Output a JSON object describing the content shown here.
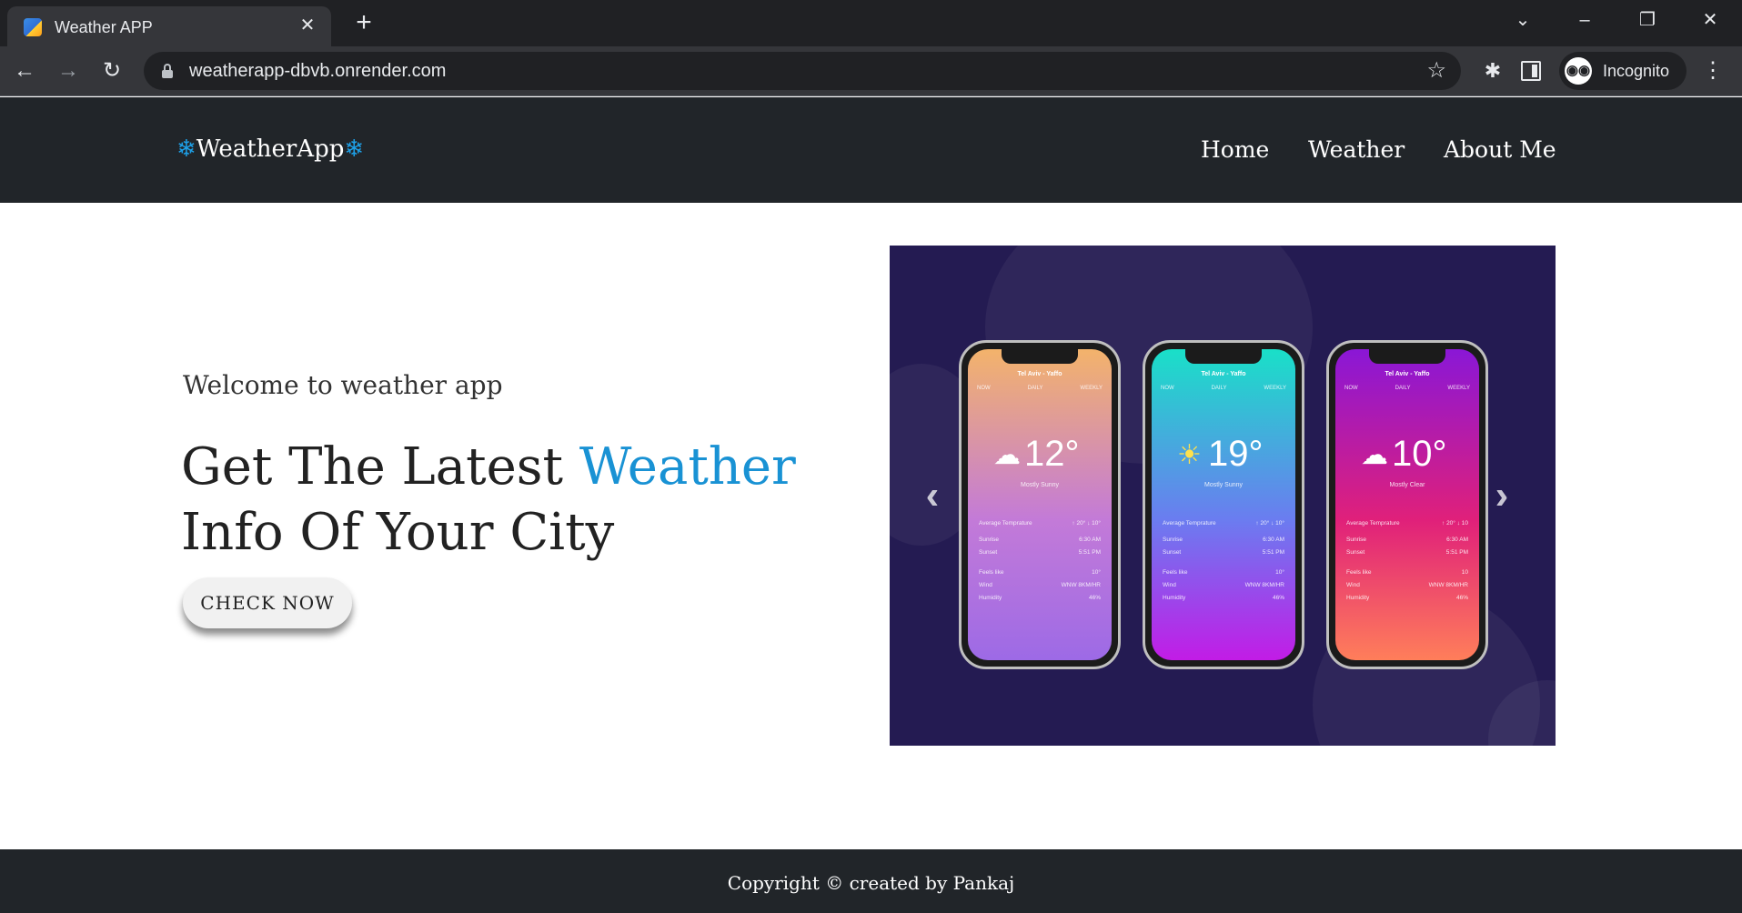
{
  "browser": {
    "tab_title": "Weather APP",
    "tab_close": "✕",
    "new_tab": "+",
    "url": "weatherapp-dbvb.onrender.com",
    "profile_label": "Incognito",
    "icons": [
      "favicon-icon",
      "close-icon",
      "plus-icon",
      "chevron-down-icon",
      "minimize-icon",
      "restore-icon",
      "close-window-icon",
      "back-icon",
      "forward-icon",
      "reload-icon",
      "lock-icon",
      "star-icon",
      "extensions-icon",
      "side-panel-icon",
      "incognito-icon",
      "menu-icon"
    ]
  },
  "site": {
    "brand": {
      "left_flake": "❄",
      "name": "WeatherApp",
      "right_flake": "❄"
    },
    "nav": [
      {
        "label": "Home"
      },
      {
        "label": "Weather"
      },
      {
        "label": "About Me"
      }
    ],
    "accent_color": "#1992d4",
    "navbar_color": "#212529"
  },
  "hero": {
    "welcome": "Welcome to weather app",
    "title_part1": "Get The Latest ",
    "title_accent": "Weather",
    "title_part2": "Info Of Your City",
    "cta_label": "CHECK NOW"
  },
  "carousel": {
    "prev_icon": "‹",
    "next_icon": "›",
    "phones": [
      {
        "city": "Tel Aviv - Yaffo",
        "tabs": [
          "NOW",
          "DAILY",
          "WEEKLY"
        ],
        "temp": "12°",
        "condition": "Mostly Sunny",
        "icon": "cloud-sun-icon",
        "gradient": [
          "#f3b36b",
          "#c37ad8",
          "#9d6ae6"
        ],
        "rows": [
          {
            "label": "Average Temprature",
            "value": "↑ 20°  ↓ 10°"
          },
          {
            "label": "Sunrise",
            "value": "6:30 AM"
          },
          {
            "label": "Sunset",
            "value": "5:51 PM"
          },
          {
            "label": "Feels like",
            "value": "10°"
          },
          {
            "label": "Wind",
            "value": "WNW 8KM/HR"
          },
          {
            "label": "Humidity",
            "value": "46%"
          }
        ]
      },
      {
        "city": "Tel Aviv - Yaffo",
        "tabs": [
          "NOW",
          "DAILY",
          "WEEKLY"
        ],
        "temp": "19°",
        "condition": "Mostly Sunny",
        "icon": "sun-icon",
        "gradient": [
          "#19e0c8",
          "#6b7cf0",
          "#c21ce6"
        ],
        "rows": [
          {
            "label": "Average Temprature",
            "value": "↑ 20°  ↓ 10°"
          },
          {
            "label": "Sunrise",
            "value": "6:30 AM"
          },
          {
            "label": "Sunset",
            "value": "5:51 PM"
          },
          {
            "label": "Feels like",
            "value": "10°"
          },
          {
            "label": "Wind",
            "value": "WNW 8KM/HR"
          },
          {
            "label": "Humidity",
            "value": "46%"
          }
        ]
      },
      {
        "city": "Tel Aviv - Yaffo",
        "tabs": [
          "NOW",
          "DAILY",
          "WEEKLY"
        ],
        "temp": "10°",
        "condition": "Mostly Clear",
        "icon": "cloud-icon",
        "gradient": [
          "#8a17d6",
          "#e0207a",
          "#ff7e5a"
        ],
        "rows": [
          {
            "label": "Average Temprature",
            "value": "↑ 20°  ↓ 10"
          },
          {
            "label": "Sunrise",
            "value": "6:30 AM"
          },
          {
            "label": "Sunset",
            "value": "5:51 PM"
          },
          {
            "label": "Feels like",
            "value": "10"
          },
          {
            "label": "Wind",
            "value": "WNW 8KM/HR"
          },
          {
            "label": "Humidity",
            "value": "46%"
          }
        ]
      }
    ]
  },
  "footer": {
    "copyright": "Copyright © created by Pankaj"
  }
}
